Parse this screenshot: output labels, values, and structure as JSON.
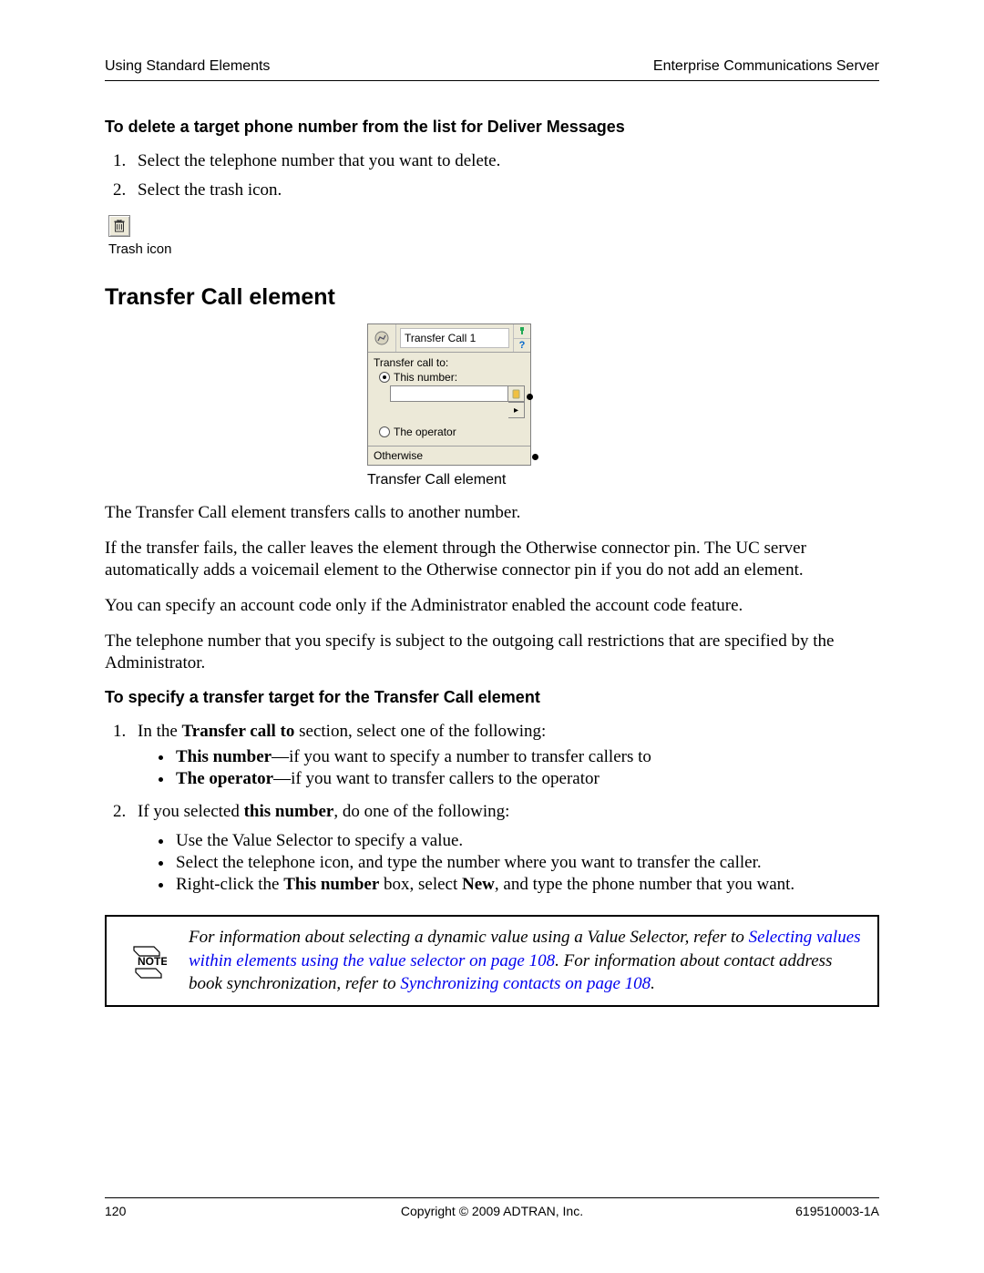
{
  "header": {
    "left": "Using Standard Elements",
    "right": "Enterprise Communications Server"
  },
  "section1": {
    "heading": "To delete a target phone number from the list for Deliver Messages",
    "steps": [
      "Select the telephone number that you want to delete.",
      "Select the trash icon."
    ],
    "trash_caption": "Trash icon"
  },
  "section2": {
    "heading": "Transfer Call element",
    "element": {
      "title": "Transfer Call 1",
      "label": "Transfer call to:",
      "opt_this_number": "This number:",
      "opt_operator": "The operator",
      "otherwise": "Otherwise",
      "caption": "Transfer Call element"
    },
    "paras": [
      "The Transfer Call element transfers calls to another number.",
      "If the transfer fails, the caller leaves the element through the Otherwise connector pin. The UC server automatically adds a voicemail element to the Otherwise connector pin if you do not add an element.",
      "You can specify an account code only if the Administrator enabled the account code feature.",
      "The telephone number that you specify is subject to the outgoing call restrictions that are specified by the Administrator."
    ]
  },
  "section3": {
    "heading": "To specify a transfer target for the Transfer Call element",
    "step1": {
      "lead_a": "In the ",
      "lead_b_bold": "Transfer call to",
      "lead_c": " section, select one of the following:",
      "bullets": [
        {
          "b": "This number",
          "rest": "—if you want to specify a number to transfer callers to"
        },
        {
          "b": "The operator",
          "rest": "—if you want to transfer callers to the operator"
        }
      ]
    },
    "step2": {
      "lead_a": "If you selected ",
      "lead_b_bold": "this number",
      "lead_c": ", do one of the following:",
      "bullets_plain": [
        "Use the Value Selector to specify a value.",
        "Select the telephone icon, and type the number where you want to transfer the caller."
      ],
      "bullet3": {
        "a": "Right-click the ",
        "b_bold": "This number",
        "c": " box, select ",
        "d_bold": "New",
        "e": ", and type the phone number that you want."
      }
    }
  },
  "note": {
    "pre": "For information about selecting a dynamic value using a Value Selector, refer to ",
    "link1": "Selecting values within elements using the value selector on page 108",
    "mid": ". For information about contact address book synchronization, refer to ",
    "link2": "Synchronizing contacts on page 108",
    "post": "."
  },
  "footer": {
    "page": "120",
    "center": "Copyright © 2009 ADTRAN, Inc.",
    "docnum": "619510003-1A"
  }
}
